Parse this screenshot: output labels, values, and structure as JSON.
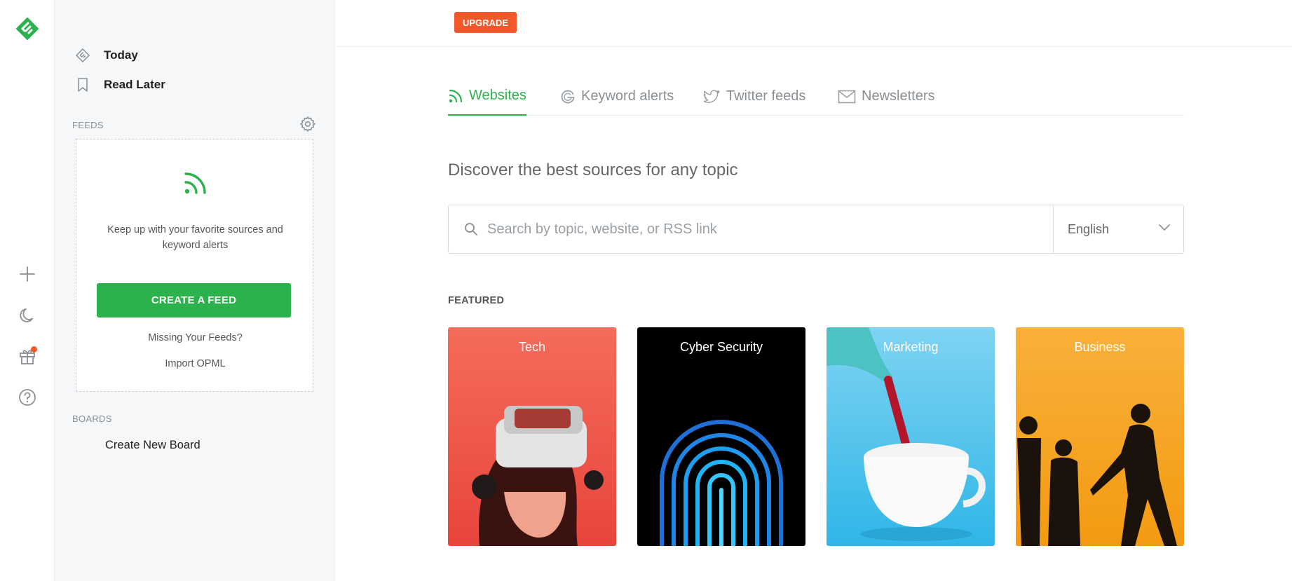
{
  "rail": {
    "logo_icon": "feedly-logo-icon",
    "add_icon": "plus-icon",
    "theme_icon": "moon-icon",
    "gift_icon": "gift-icon",
    "help_icon": "help-circle-icon",
    "gift_badge_color": "#f1592a"
  },
  "nav": {
    "today_label": "Today",
    "read_later_label": "Read Later",
    "feeds_section": "FEEDS",
    "boards_section": "BOARDS",
    "create_board_label": "Create New Board"
  },
  "feed_card": {
    "blurb": "Keep up with your favorite sources and keyword alerts",
    "create_button": "CREATE A FEED",
    "missing_link": "Missing Your Feeds?",
    "import_link": "Import OPML"
  },
  "topbar": {
    "upgrade_label": "UPGRADE"
  },
  "tabs": [
    {
      "label": "Websites",
      "icon": "rss-icon",
      "active": true
    },
    {
      "label": "Keyword alerts",
      "icon": "google-icon",
      "active": false
    },
    {
      "label": "Twitter feeds",
      "icon": "twitter-icon",
      "active": false
    },
    {
      "label": "Newsletters",
      "icon": "mail-icon",
      "active": false
    }
  ],
  "main": {
    "headline": "Discover the best sources for any topic",
    "search_placeholder": "Search by topic, website, or RSS link",
    "language_value": "English",
    "featured_label": "FEATURED"
  },
  "featured": [
    {
      "title": "Tech"
    },
    {
      "title": "Cyber Security"
    },
    {
      "title": "Marketing"
    },
    {
      "title": "Business"
    }
  ],
  "colors": {
    "accent_green": "#2bb24c",
    "upgrade_orange": "#f1592a",
    "sidebar_bg": "#f6f7f8"
  }
}
